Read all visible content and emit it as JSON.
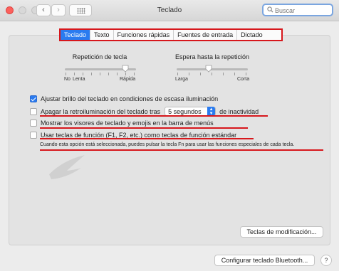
{
  "window": {
    "title": "Teclado"
  },
  "toolbar": {
    "back_icon": "chevron-left-icon",
    "forward_icon": "chevron-right-icon",
    "grid_icon": "grid-icon",
    "search_placeholder": "Buscar"
  },
  "tabs": [
    {
      "label": "Teclado",
      "active": true
    },
    {
      "label": "Texto",
      "active": false
    },
    {
      "label": "Funciones rápidas",
      "active": false
    },
    {
      "label": "Fuentes de entrada",
      "active": false
    },
    {
      "label": "Dictado",
      "active": false
    }
  ],
  "key_repeat": {
    "label": "Repetición de tecla",
    "min_label": "No",
    "low_label": "Lenta",
    "max_label": "Rápida",
    "value_fraction": 0.85
  },
  "repeat_delay": {
    "label": "Espera hasta la repetición",
    "min_label": "Larga",
    "max_label": "Corta",
    "value_fraction": 0.45
  },
  "options": {
    "brightness": {
      "label": "Ajustar brillo del teclado en condiciones de escasa iluminación",
      "checked": true
    },
    "backlight_off": {
      "label": "Apagar la retroiluminación del teclado tras",
      "checked": false,
      "select_value": "5 segundos",
      "suffix": "de inactividad"
    },
    "show_viewers": {
      "label": "Mostrar los visores de teclado y emojis en la barra de menús",
      "checked": false
    },
    "fn_keys": {
      "label": "Usar teclas de función (F1, F2, etc.) como teclas de función estándar",
      "checked": false,
      "help": "Cuando esta opción está seleccionada, puedes pulsar la tecla Fn para usar las funciones especiales de cada tecla."
    }
  },
  "buttons": {
    "modifier_keys": "Teclas de modificación...",
    "bluetooth": "Configurar teclado Bluetooth...",
    "help": "?"
  },
  "colors": {
    "accent": "#2a7bf0",
    "annotation": "#d7171c"
  }
}
